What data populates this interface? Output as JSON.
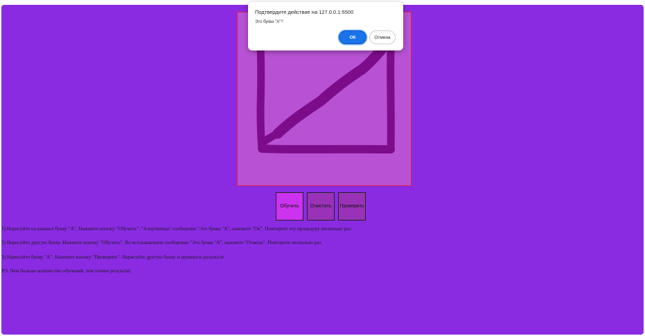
{
  "colors": {
    "page_bg": "#8a2be2",
    "canvas_bg": "#b852d4",
    "canvas_border": "#e01e4a",
    "stroke": "#7d0c8a",
    "train_button_bg": "#cc33ee",
    "other_button_bg": "#9a32b8",
    "dialog_ok_bg": "#1a73e8"
  },
  "canvas": {
    "drawing": "letter-like square with diagonal stroke"
  },
  "buttons": {
    "train_label": "Обучить",
    "clear_label": "Очистить",
    "check_label": "Проверить"
  },
  "instructions": [
    "1) Нарисуйте на канвасе букву \"А\". Нажмите кнопку \"Обучить\". \"Алертяница\" сообщение \"Это буква \"А\", нажмите \"Ок\". Повторите эту процедуру несколько раз.",
    "2) Нарисуйте другую букву. Нажмите кнопку \"Обучить\". Во всплывающем сообщении \"Это буква \"А\", нажмите \"Отмена\". Повторите несколько раз.",
    "3) Нарисуйте букву \"А\". Нажмите кнопку \"Проверить\". Нарисуйте другую букву и проверьте результат.",
    "P.S. Чем больше количество обучений, тем точнее результат."
  ],
  "dialog": {
    "title": "Подтвердите действие на 127.0.0.1:5500",
    "message": "Это буква \"А\"?",
    "ok_label": "ОК",
    "cancel_label": "Отмена"
  }
}
